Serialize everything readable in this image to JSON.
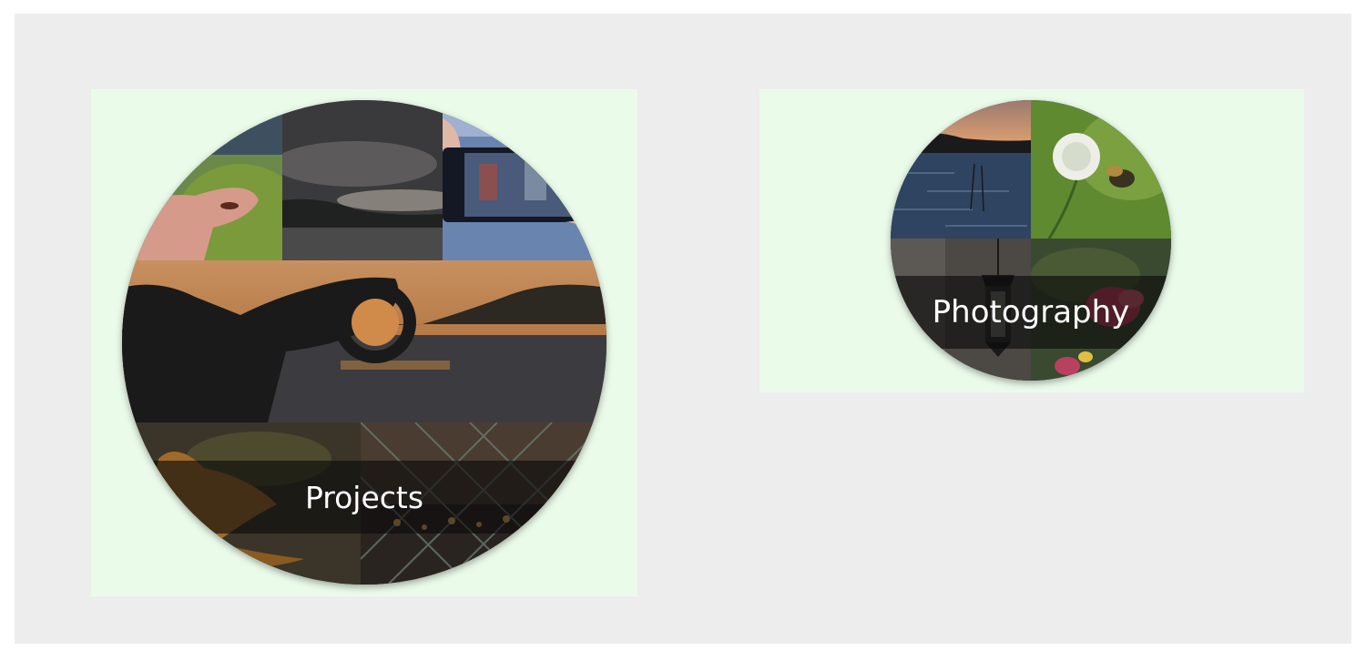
{
  "categories": [
    {
      "id": "projects",
      "label": "Projects",
      "photos": [
        "hand-with-beetle",
        "cloudy-lake",
        "phone-city-street",
        "sunset-ring-silhouette",
        "autumn-leaf",
        "fence-bokeh-lights"
      ]
    },
    {
      "id": "photography",
      "label": "Photography",
      "photos": [
        "lake-dusk",
        "clover-bee",
        "hanging-lantern",
        "pink-flowers"
      ]
    }
  ],
  "colors": {
    "page_background": "#ededed",
    "card_background": "#ebfbea",
    "label_band": "#0a0a0a",
    "label_text": "#ffffff"
  }
}
